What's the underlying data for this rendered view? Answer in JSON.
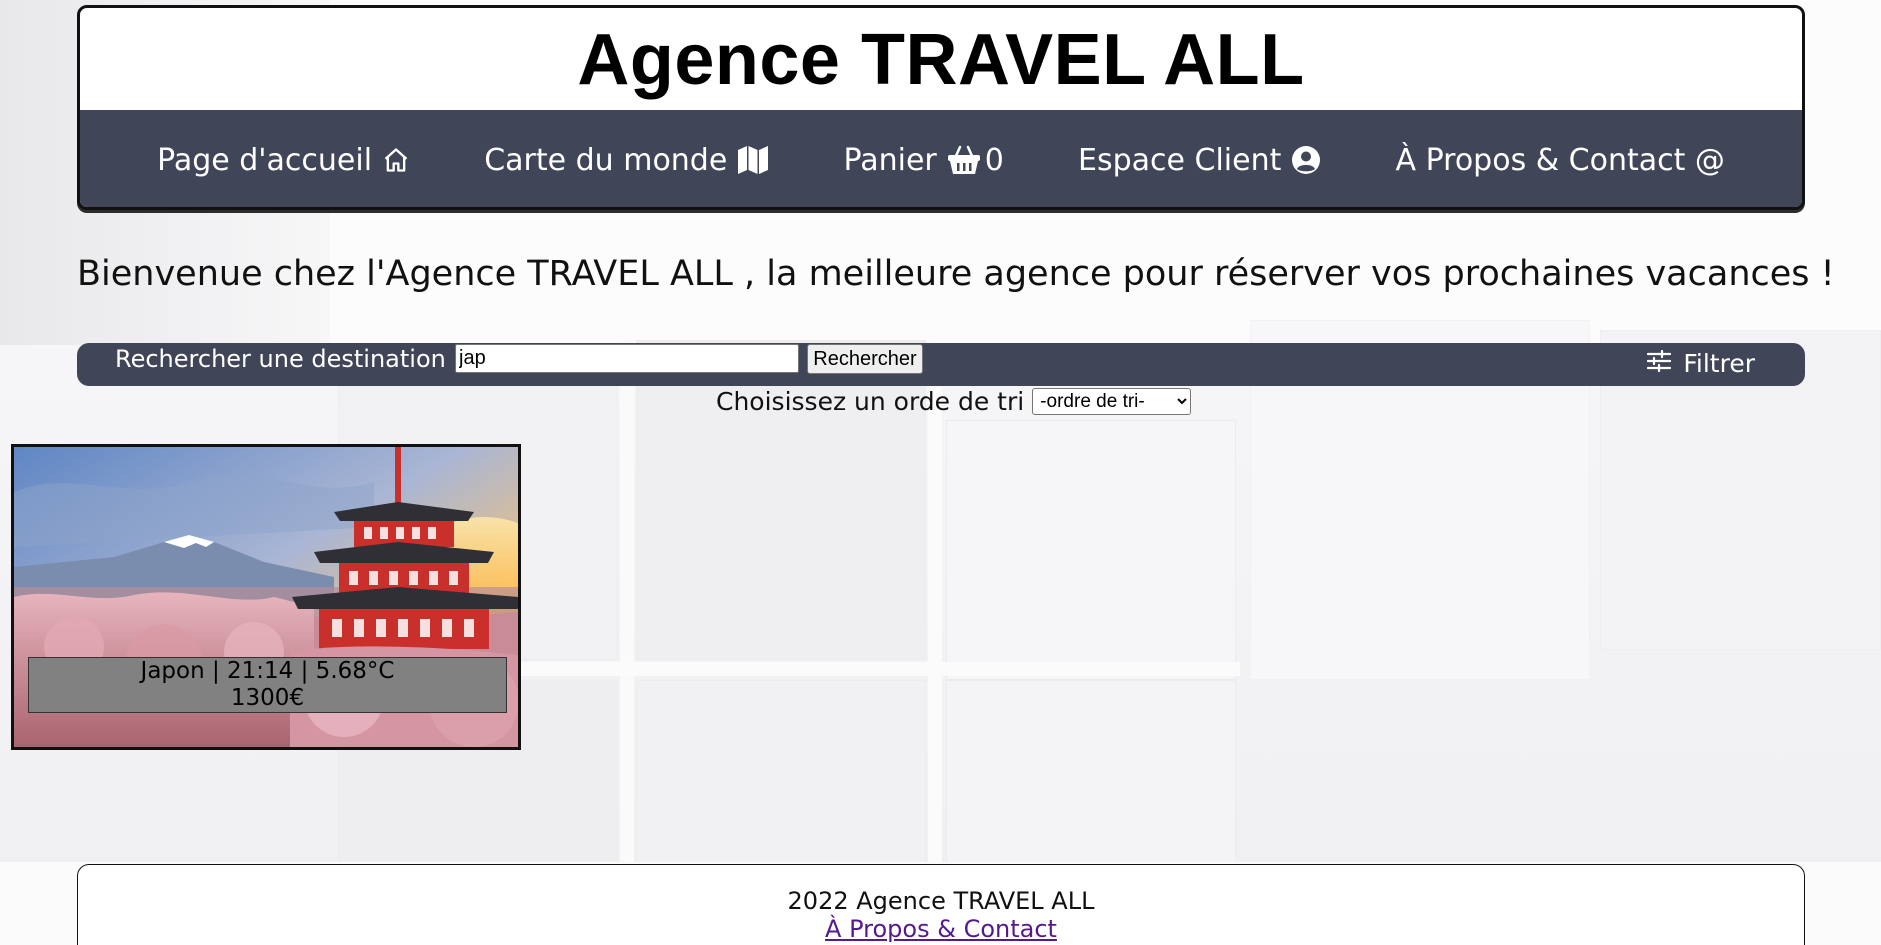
{
  "site": {
    "title": "Agence TRAVEL ALL"
  },
  "nav": {
    "items": [
      {
        "label": "Page d'accueil",
        "icon": "home-icon"
      },
      {
        "label": "Carte du monde",
        "icon": "map-icon"
      },
      {
        "label": "Panier",
        "icon": "basket-icon",
        "count": "0"
      },
      {
        "label": "Espace Client",
        "icon": "user-circle-icon"
      },
      {
        "label": "À Propos & Contact @",
        "icon": ""
      }
    ]
  },
  "welcome": {
    "text": "Bienvenue chez l'Agence TRAVEL ALL , la meilleure agence pour réserver vos prochaines vacances !"
  },
  "search": {
    "label": "Rechercher une destination :",
    "value": "jap",
    "button_label": "Rechercher",
    "filter_label": "Filtrer",
    "filter_icon": "sliders-icon"
  },
  "sort": {
    "label": "Choisissez un orde de tri",
    "selected": "-ordre de tri-"
  },
  "results": [
    {
      "country": "Japon",
      "time": "21:14",
      "temperature": "5.68°C",
      "line1": "Japon | 21:14 | 5.68°C",
      "price": "1300€"
    }
  ],
  "footer": {
    "copyright": "2022 Agence TRAVEL ALL",
    "link": "À Propos & Contact"
  },
  "colors": {
    "nav_bg": "#414558",
    "caption_bg": "#818181",
    "link_visited": "#551a8b"
  }
}
